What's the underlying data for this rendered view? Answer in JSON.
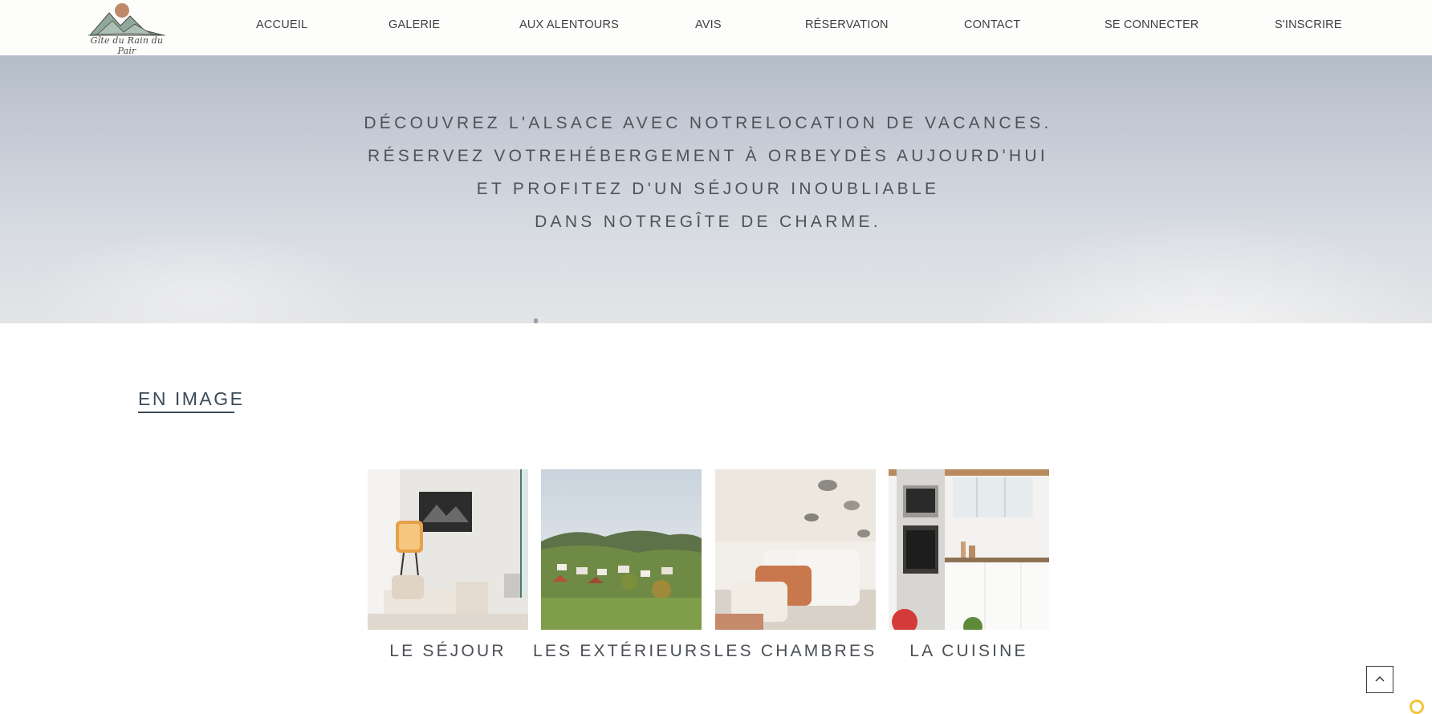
{
  "header": {
    "logo_text": "Gîte du Rain du Pair",
    "nav": [
      {
        "label": "ACCUEIL"
      },
      {
        "label": "GALERIE"
      },
      {
        "label": "AUX ALENTOURS"
      },
      {
        "label": "AVIS"
      },
      {
        "label": "RÉSERVATION"
      },
      {
        "label": "CONTACT"
      },
      {
        "label": "SE CONNECTER"
      },
      {
        "label": "S'INSCRIRE"
      }
    ]
  },
  "hero": {
    "lines": [
      "DÉCOUVREZ L'ALSACE AVEC NOTRELOCATION DE VACANCES.",
      "RÉSERVEZ VOTREHÉBERGEMENT À ORBEYDÈS AUJOURD'HUI",
      "ET PROFITEZ D'UN SÉJOUR INOUBLIABLE",
      "DANS NOTREGÎTE DE CHARME."
    ]
  },
  "gallery": {
    "title": "EN IMAGE",
    "cards": [
      {
        "label": "LE SÉJOUR",
        "image": "living-room-photo"
      },
      {
        "label": "LES EXTÉRIEURS",
        "image": "village-landscape-photo"
      },
      {
        "label": "LES CHAMBRES",
        "image": "bedroom-cushions-photo"
      },
      {
        "label": "LA CUISINE",
        "image": "kitchen-photo"
      }
    ]
  },
  "icons": {
    "scroll_top": "chevron-up-icon"
  },
  "colors": {
    "nav_text": "#3f3f3f",
    "hero_text": "#4e535a",
    "section_title": "#3b4a57",
    "accent_sun": "#c08a6a",
    "corner_mark": "#f3c33a"
  }
}
